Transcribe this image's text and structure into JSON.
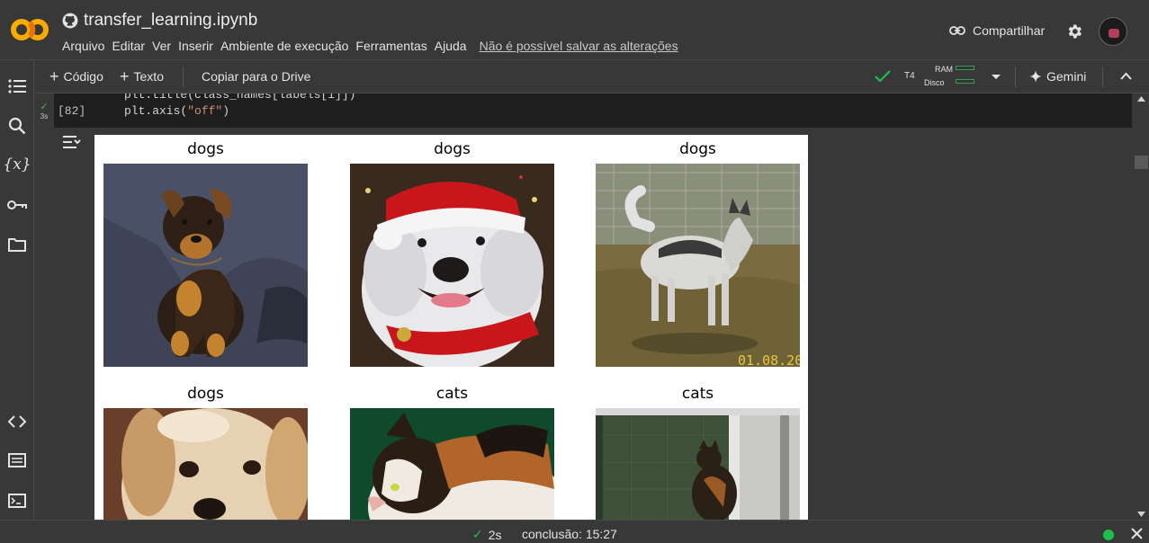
{
  "header": {
    "title": "transfer_learning.ipynb",
    "menu": [
      "Arquivo",
      "Editar",
      "Ver",
      "Inserir",
      "Ambiente de execução",
      "Ferramentas",
      "Ajuda"
    ],
    "save_warning": "Não é possível salvar as alterações",
    "share_label": "Compartilhar"
  },
  "toolbar": {
    "add_code": "Código",
    "add_text": "Texto",
    "copy_drive": "Copiar para o Drive",
    "runtime": "T4",
    "ram_label": "RAM",
    "disk_label": "Disco",
    "gemini_label": "Gemini"
  },
  "cell": {
    "exec_count": "[82]",
    "run_time": "3s",
    "code_line1": "plt.title(class_names[labels[i]])",
    "code_line2_fn": "plt.axis(",
    "code_line2_str": "\"off\"",
    "code_line2_end": ")"
  },
  "figure": {
    "labels": [
      "dogs",
      "dogs",
      "dogs",
      "dogs",
      "cats",
      "cats"
    ],
    "photo3_timestamp": "01.08.20"
  },
  "status": {
    "elapsed": "2s",
    "completed": "conclusão: 15:27"
  },
  "colors": {
    "accent_green": "#1fbf4e",
    "logo_orange": "#f9ab00"
  }
}
